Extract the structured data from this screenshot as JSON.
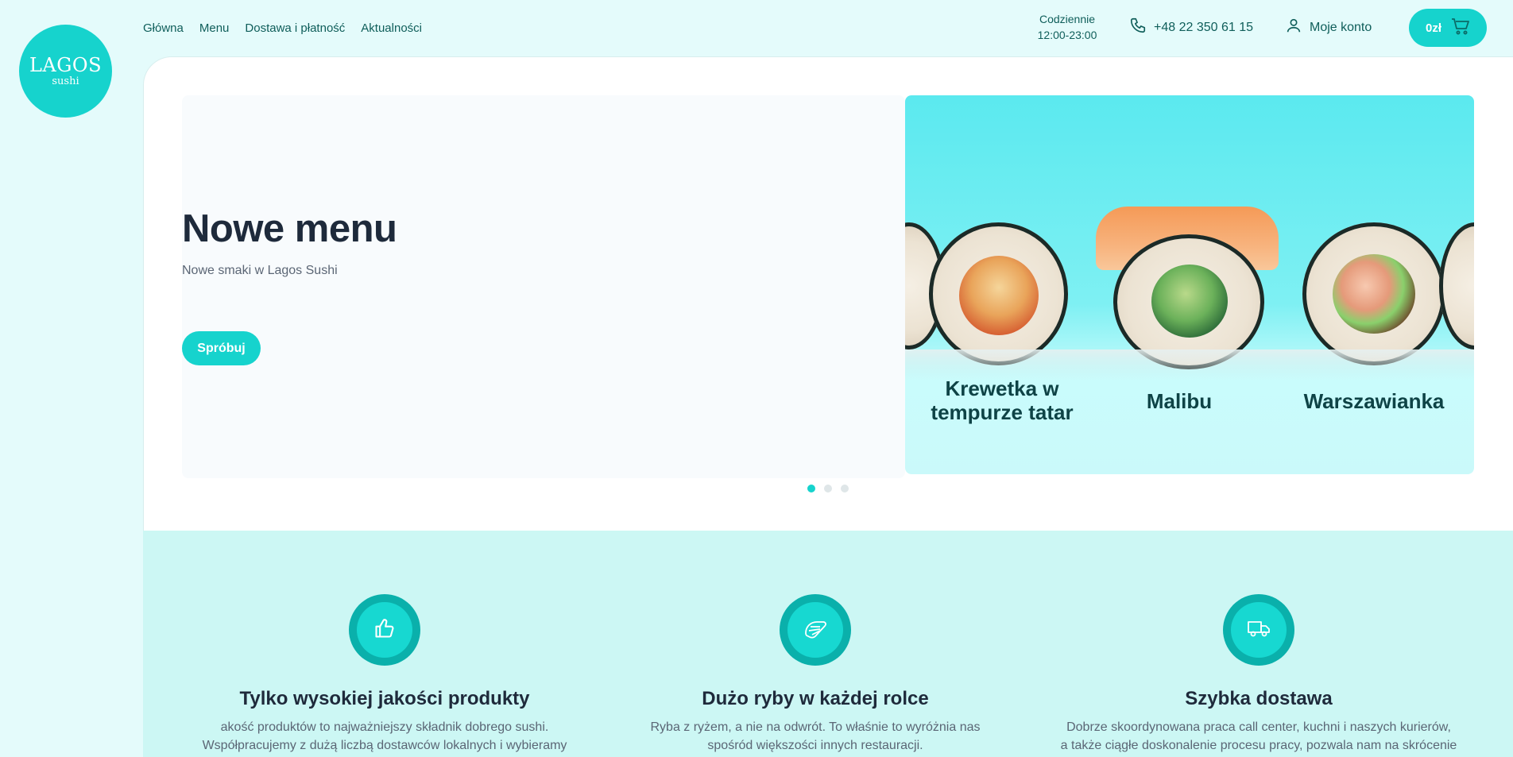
{
  "logo": {
    "brand": "LAGOS",
    "sub": "sushi"
  },
  "nav": {
    "items": [
      {
        "label": "Główna"
      },
      {
        "label": "Menu"
      },
      {
        "label": "Dostawa i płatność"
      },
      {
        "label": "Aktualności"
      }
    ]
  },
  "header": {
    "hours_line1": "Codziennie",
    "hours_line2": "12:00-23:00",
    "phone": "+48 22 350 61 15",
    "account": "Moje konto",
    "cart_total": "0zł"
  },
  "hero": {
    "title": "Nowe menu",
    "subtitle": "Nowe smaki w Lagos Sushi",
    "button": "Spróbuj",
    "products": [
      {
        "name": "Krewetka w tempurze tatar"
      },
      {
        "name": "Malibu"
      },
      {
        "name": "Warszawianka"
      }
    ],
    "slides": 3,
    "active_slide": 1
  },
  "features": [
    {
      "icon": "thumbs-up-icon",
      "title": "Tylko wysokiej jakości produkty",
      "line1": "akość produktów to najważniejszy składnik dobrego sushi.",
      "line2": "Współpracujemy z dużą liczbą dostawców lokalnych i wybieramy"
    },
    {
      "icon": "sushi-roll-icon",
      "title": "Dużo ryby w każdej rolce",
      "line1": "Ryba z ryżem, a nie na odwrót. To właśnie to wyróżnia nas",
      "line2": "spośród większości innych restauracji."
    },
    {
      "icon": "delivery-truck-icon",
      "title": "Szybka dostawa",
      "line1": "Dobrze skoordynowana praca call center, kuchni i naszych kurierów,",
      "line2": "a także ciągłe doskonalenie procesu pracy, pozwala nam na skrócenie"
    }
  ],
  "colors": {
    "accent": "#16d3cd",
    "dark_accent": "#0ab0ab",
    "background": "#e4fbfb",
    "heading": "#1e2a3b",
    "nav_text": "#0f5e5a"
  }
}
